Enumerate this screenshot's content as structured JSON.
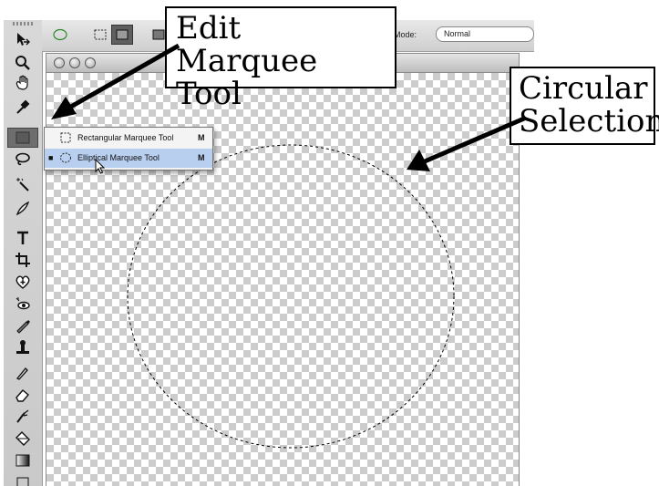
{
  "options_bar": {
    "mode_label": "Mode:",
    "mode_value": "Normal"
  },
  "flyout_menu": {
    "items": [
      {
        "label": "Rectangular Marquee Tool",
        "shortcut": "M",
        "checked": "",
        "icon": "rectangle-marquee-icon"
      },
      {
        "label": "Elliptical Marquee Tool",
        "shortcut": "M",
        "checked": "■",
        "icon": "ellipse-marquee-icon"
      }
    ]
  },
  "callouts": {
    "edit_tool": {
      "line1": "Edit Marquee",
      "line2": "Tool"
    },
    "circular_selection": {
      "line1": "Circular",
      "line2": "Selection"
    }
  },
  "tools": [
    "move-icon",
    "zoom-icon",
    "hand-icon",
    "eyedropper-icon",
    "marquee-icon",
    "lasso-icon",
    "magic-wand-icon",
    "brush-icon",
    "type-icon",
    "crop-icon",
    "healing-icon",
    "red-eye-icon",
    "pencil-brush-icon",
    "stamp-icon",
    "pen-icon",
    "eraser-icon",
    "smudge-icon",
    "paint-bucket-icon",
    "gradient-icon"
  ],
  "colors": {
    "menu_highlight": "#b8cff0",
    "active_tool": "#6e6e6e"
  }
}
